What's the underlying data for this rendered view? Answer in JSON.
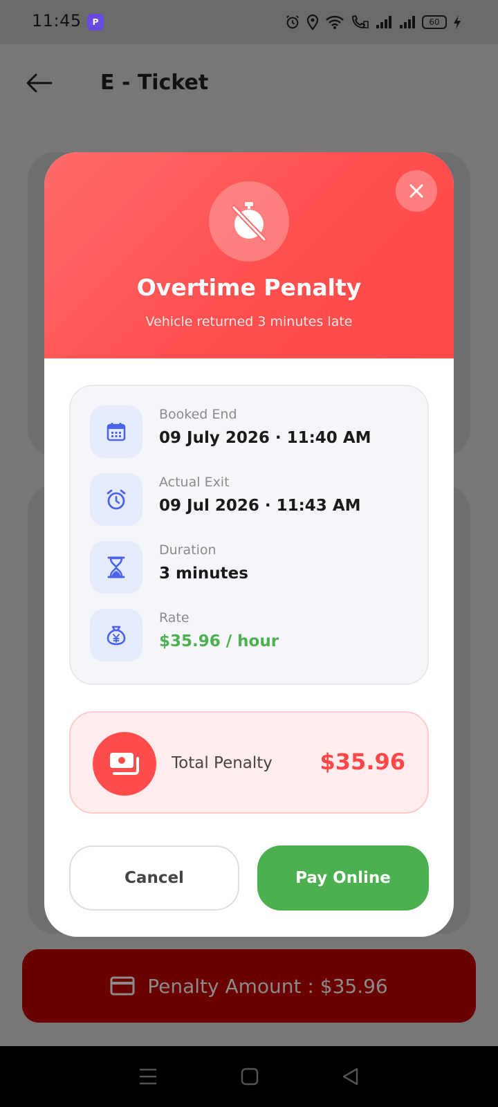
{
  "status_bar": {
    "time": "11:45",
    "app_badge": "P",
    "battery": "60"
  },
  "app_bar": {
    "title": "E - Ticket"
  },
  "modal": {
    "title": "Overtime Penalty",
    "subtitle": "Vehicle returned 3 minutes late",
    "details": [
      {
        "label": "Booked End",
        "value": "09 July 2026 · 11:40 AM",
        "icon": "calendar-icon"
      },
      {
        "label": "Actual Exit",
        "value": "09 Jul 2026 · 11:43 AM",
        "icon": "alarm-clock-icon"
      },
      {
        "label": "Duration",
        "value": "3 minutes",
        "icon": "hourglass-icon"
      },
      {
        "label": "Rate",
        "value": "$35.96 / hour",
        "icon": "money-bag-icon"
      }
    ],
    "total_label": "Total Penalty",
    "total_amount": "$35.96",
    "cancel_label": "Cancel",
    "pay_label": "Pay Online"
  },
  "penalty_bar": {
    "text": "Penalty Amount : $35.96"
  },
  "colors": {
    "header_red": "#ff5252",
    "pay_green": "#4caf50",
    "total_red": "#ff4747",
    "icon_blue": "#4a64e8"
  }
}
